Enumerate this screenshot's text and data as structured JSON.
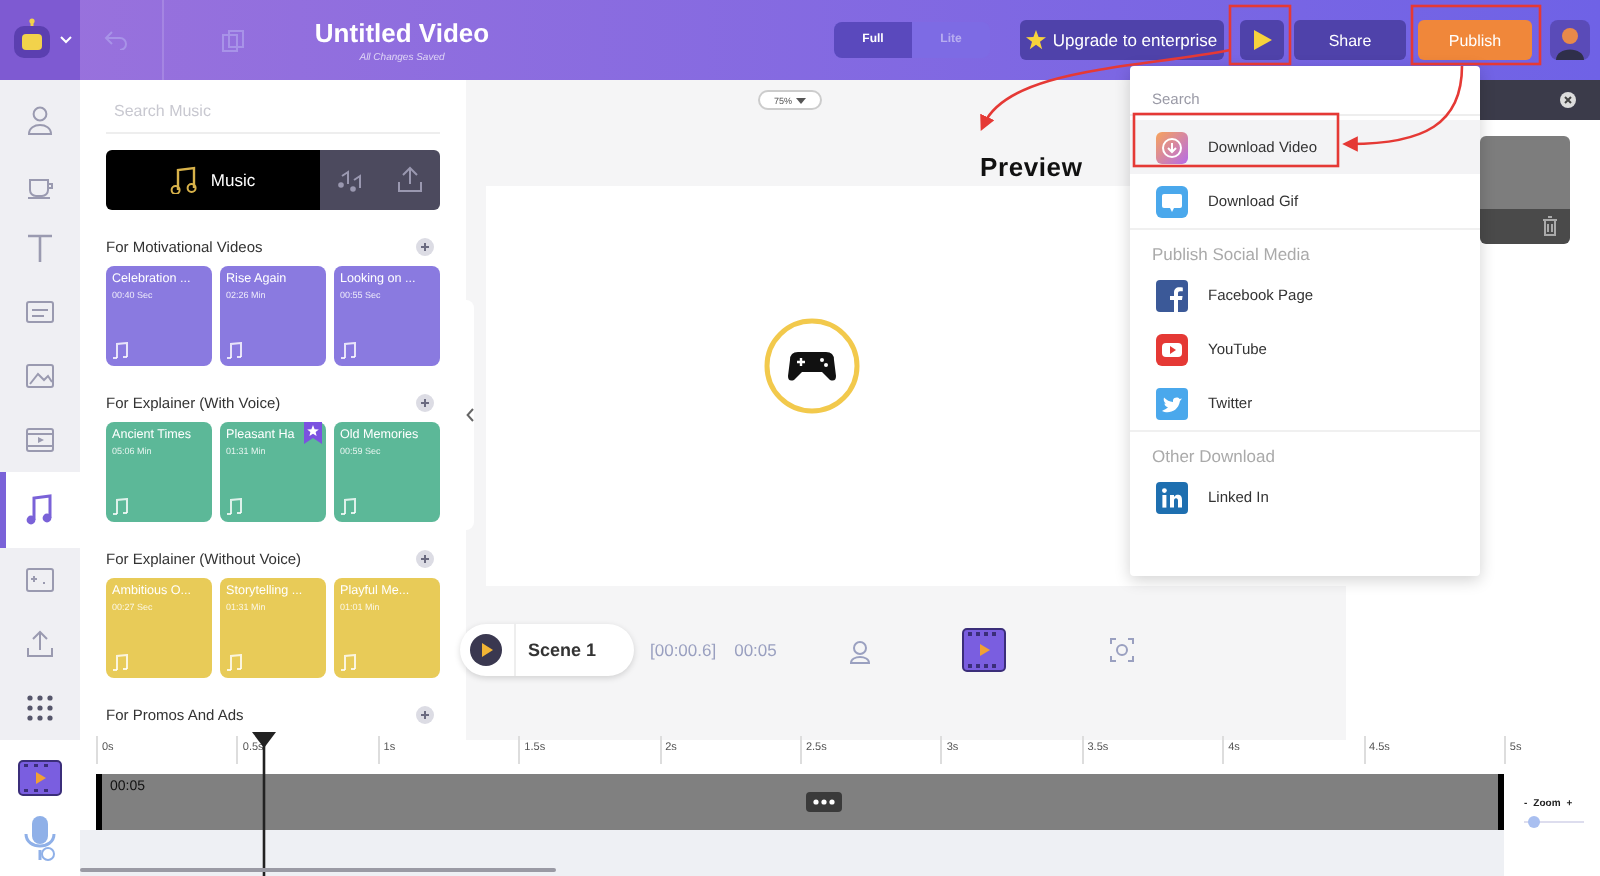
{
  "header": {
    "title": "Untitled Video",
    "subtitle": "All Changes Saved",
    "modes": [
      {
        "label": "Full",
        "selected": true
      },
      {
        "label": "Lite",
        "selected": false
      }
    ],
    "upgrade": "Upgrade to enterprise",
    "share": "Share",
    "publish": "Publish"
  },
  "rail": [
    {
      "selected": false
    },
    {
      "selected": false
    },
    {
      "selected": false
    },
    {
      "selected": false
    },
    {
      "selected": false
    },
    {
      "selected": false
    },
    {
      "selected": true
    },
    {
      "selected": false
    },
    {
      "selected": false
    },
    {
      "selected": false
    }
  ],
  "music_panel": {
    "search_placeholder": "Search Music",
    "tabs": [
      {
        "label": "Music",
        "selected": true
      },
      {
        "selected": false
      },
      {
        "selected": false
      }
    ],
    "sections": [
      {
        "title": "For Motivational Videos",
        "color": "#8a7ae0",
        "tracks": [
          {
            "name": "Celebration ...",
            "duration": "00:40 Sec",
            "starred": false
          },
          {
            "name": "Rise Again",
            "duration": "02:26 Min",
            "starred": false
          },
          {
            "name": "Looking on ...",
            "duration": "00:55 Sec",
            "starred": false
          }
        ]
      },
      {
        "title": "For Explainer (With Voice)",
        "color": "#5cb898",
        "tracks": [
          {
            "name": "Ancient Times",
            "duration": "05:06 Min",
            "starred": false
          },
          {
            "name": "Pleasant Ha",
            "duration": "01:31 Min",
            "starred": true
          },
          {
            "name": "Old Memories",
            "duration": "00:59 Sec",
            "starred": false
          }
        ]
      },
      {
        "title": "For Explainer (Without Voice)",
        "color": "#e8cb58",
        "tracks": [
          {
            "name": "Ambitious O...",
            "duration": "00:27 Sec",
            "starred": false
          },
          {
            "name": "Storytelling ...",
            "duration": "01:31 Min",
            "starred": false
          },
          {
            "name": "Playful Me...",
            "duration": "01:01 Min",
            "starred": false
          }
        ]
      },
      {
        "title": "For Promos And Ads"
      }
    ]
  },
  "canvas": {
    "zoom": "75%",
    "scene": {
      "name": "Scene 1",
      "start": "[00:00.6]",
      "duration": "00:05"
    }
  },
  "publish_menu": {
    "search_placeholder": "Search",
    "items": [
      {
        "kind": "option",
        "label": "Download Video",
        "selected": true
      },
      {
        "kind": "option",
        "label": "Download Gif",
        "selected": false
      },
      {
        "kind": "heading",
        "label": "Publish Social Media"
      },
      {
        "kind": "option",
        "label": "Facebook Page",
        "selected": false
      },
      {
        "kind": "option",
        "label": "YouTube",
        "selected": false
      },
      {
        "kind": "option",
        "label": "Twitter",
        "selected": false
      },
      {
        "kind": "heading",
        "label": "Other Download"
      },
      {
        "kind": "option",
        "label": "Linked In",
        "selected": false
      }
    ]
  },
  "annotation": "Preview",
  "timeline": {
    "ticks": [
      "0s",
      "0.5s",
      "1s",
      "1.5s",
      "2s",
      "2.5s",
      "3s",
      "3.5s",
      "4s",
      "4.5s",
      "5s"
    ],
    "clip": "00:05",
    "zoom": {
      "minus": "-",
      "label": "Zoom",
      "plus": "+",
      "level": 0.05
    }
  }
}
